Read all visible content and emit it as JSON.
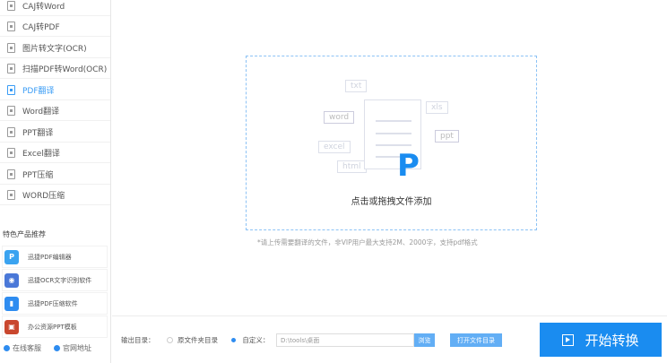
{
  "sidebar": {
    "items": [
      {
        "label": "CAJ转Word"
      },
      {
        "label": "CAJ转PDF"
      },
      {
        "label": "图片转文字(OCR)"
      },
      {
        "label": "扫描PDF转Word(OCR)"
      },
      {
        "label": "PDF翻译",
        "active": true
      },
      {
        "label": "Word翻译"
      },
      {
        "label": "PPT翻译"
      },
      {
        "label": "Excel翻译"
      },
      {
        "label": "PPT压缩"
      },
      {
        "label": "WORD压缩"
      }
    ],
    "section_title": "特色产品推荐",
    "products": [
      {
        "label": "迅捷PDF编辑器"
      },
      {
        "label": "迅捷OCR文字识别软件"
      },
      {
        "label": "迅捷PDF压缩软件"
      },
      {
        "label": "办公资源PPT模板"
      }
    ],
    "links": {
      "service": "在线客服",
      "website": "官网地址"
    }
  },
  "drop": {
    "tags": {
      "txt": "txt",
      "word": "word",
      "xls": "xls",
      "ppt": "ppt",
      "excel": "excel",
      "html": "html"
    },
    "logo": "P",
    "label": "点击或拖拽文件添加",
    "hint": "*请上传需要翻译的文件，非VIP用户最大支持2M、2000字，支持pdf格式"
  },
  "bottom": {
    "output_label": "输出目录：",
    "option_source": "原文件夹目录",
    "option_custom": "自定义：",
    "path": "D:\\tools\\桌面",
    "browse": "浏览",
    "open_dir": "打开文件目录",
    "start": "开始转换"
  },
  "colors": {
    "accent": "#1a8cf0"
  }
}
